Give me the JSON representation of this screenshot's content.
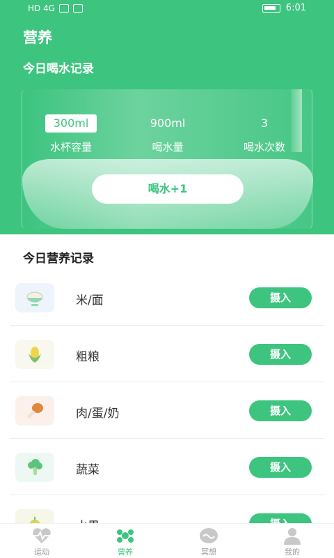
{
  "status_bar": {
    "left": "HD 4G",
    "time": "6:01"
  },
  "header": {
    "title": "营养"
  },
  "water": {
    "title": "今日喝水记录",
    "stats": [
      {
        "value": "300ml",
        "label": "水杯容量"
      },
      {
        "value": "900ml",
        "label": "喝水量"
      },
      {
        "value": "3",
        "label": "喝水次数"
      }
    ],
    "button": "喝水+1"
  },
  "nutrition": {
    "title": "今日营养记录",
    "items": [
      {
        "name": "米/面",
        "icon": "rice-bowl-icon",
        "button": "摄入"
      },
      {
        "name": "粗粮",
        "icon": "corn-icon",
        "button": "摄入"
      },
      {
        "name": "肉/蛋/奶",
        "icon": "drumstick-icon",
        "button": "摄入"
      },
      {
        "name": "蔬菜",
        "icon": "broccoli-icon",
        "button": "摄入"
      },
      {
        "name": "水果",
        "icon": "fruit-icon",
        "button": "摄入"
      }
    ]
  },
  "tabs": [
    {
      "label": "运动",
      "icon": "heartbeat-icon"
    },
    {
      "label": "营养",
      "icon": "nutrition-icon"
    },
    {
      "label": "冥想",
      "icon": "meditation-icon"
    },
    {
      "label": "我的",
      "icon": "profile-icon"
    }
  ],
  "colors": {
    "accent": "#3dc47f"
  }
}
